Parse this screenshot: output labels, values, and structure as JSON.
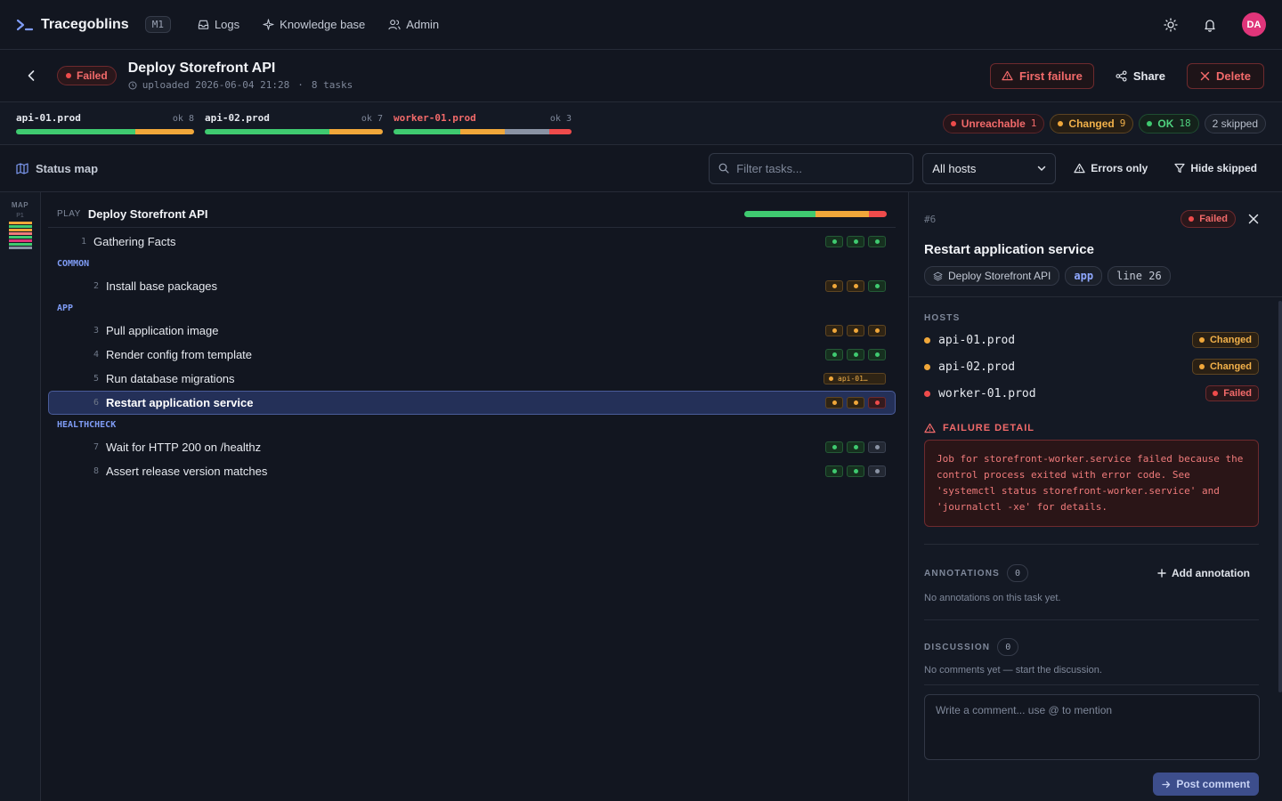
{
  "nav": {
    "brand": "Tracegoblins",
    "badge": "M1",
    "links": [
      {
        "label": "Logs",
        "icon": "inbox-icon"
      },
      {
        "label": "Knowledge base",
        "icon": "sparkle-icon"
      },
      {
        "label": "Admin",
        "icon": "users-icon"
      }
    ],
    "avatar": "DA"
  },
  "run": {
    "status": "Failed",
    "title": "Deploy Storefront API",
    "uploaded": "uploaded 2026-06-04 21:28",
    "separator": "·",
    "tasks": "8 tasks",
    "actions": {
      "first_failure": "First failure",
      "share": "Share",
      "delete": "Delete"
    }
  },
  "hosts": [
    {
      "name": "api-01.prod",
      "ok": "ok 8",
      "failed": false,
      "segments": [
        {
          "color": "#3fca70",
          "fraction": 0.67
        },
        {
          "color": "#f0a73a",
          "fraction": 0.33
        }
      ]
    },
    {
      "name": "api-02.prod",
      "ok": "ok 7",
      "failed": false,
      "segments": [
        {
          "color": "#3fca70",
          "fraction": 0.7
        },
        {
          "color": "#f0a73a",
          "fraction": 0.3
        }
      ]
    },
    {
      "name": "worker-01.prod",
      "ok": "ok 3",
      "failed": true,
      "segments": [
        {
          "color": "#3fca70",
          "fraction": 0.375
        },
        {
          "color": "#f0a73a",
          "fraction": 0.25
        },
        {
          "color": "#8a93a4",
          "fraction": 0.25
        },
        {
          "color": "#ef4b4b",
          "fraction": 0.125
        }
      ]
    }
  ],
  "summary": {
    "unreachable": {
      "label": "Unreachable",
      "count": "1"
    },
    "changed": {
      "label": "Changed",
      "count": "9"
    },
    "ok": {
      "label": "OK",
      "count": "18"
    },
    "skipped": "2 skipped"
  },
  "toolbar": {
    "status_map": "Status map",
    "filter_placeholder": "Filter tasks...",
    "host_select": "All hosts",
    "errors_only": "Errors only",
    "hide_skipped": "Hide skipped"
  },
  "minimap": {
    "label": "MAP",
    "sub": "P1"
  },
  "play": {
    "keyword": "PLAY",
    "name": "Deploy Storefront API",
    "bar": [
      {
        "color": "#3fca70",
        "fraction": 0.5
      },
      {
        "color": "#f0a73a",
        "fraction": 0.375
      },
      {
        "color": "#ef4b4b",
        "fraction": 0.125
      }
    ]
  },
  "task_rows": [
    {
      "kind": "task",
      "num": "1",
      "name": "Gathering Facts",
      "indent": 0,
      "dots": [
        "ok",
        "ok",
        "ok"
      ]
    },
    {
      "kind": "role",
      "name": "COMMON"
    },
    {
      "kind": "task",
      "num": "2",
      "name": "Install base packages",
      "indent": 1,
      "dots": [
        "changed",
        "changed",
        "ok"
      ]
    },
    {
      "kind": "role",
      "name": "APP"
    },
    {
      "kind": "task",
      "num": "3",
      "name": "Pull application image",
      "indent": 1,
      "dots": [
        "changed",
        "changed",
        "changed"
      ]
    },
    {
      "kind": "task",
      "num": "4",
      "name": "Render config from template",
      "indent": 1,
      "dots": [
        "ok",
        "ok",
        "ok"
      ]
    },
    {
      "kind": "task",
      "num": "5",
      "name": "Run database migrations",
      "indent": 1,
      "wide": "api-01…"
    },
    {
      "kind": "task",
      "num": "6",
      "name": "Restart application service",
      "indent": 1,
      "selected": true,
      "dots": [
        "changed",
        "changed",
        "failed"
      ]
    },
    {
      "kind": "role",
      "name": "HEALTHCHECK"
    },
    {
      "kind": "task",
      "num": "7",
      "name": "Wait for HTTP 200 on /healthz",
      "indent": 1,
      "dots": [
        "ok",
        "ok",
        "skipped"
      ]
    },
    {
      "kind": "task",
      "num": "8",
      "name": "Assert release version matches",
      "indent": 1,
      "dots": [
        "ok",
        "ok",
        "skipped"
      ]
    }
  ],
  "detail": {
    "id": "#6",
    "status": "Failed",
    "title": "Restart application service",
    "chips": {
      "play": "Deploy Storefront API",
      "role": "app",
      "line": "line 26"
    },
    "hosts_label": "HOSTS",
    "hosts": [
      {
        "name": "api-01.prod",
        "status": "Changed",
        "kind": "changed"
      },
      {
        "name": "api-02.prod",
        "status": "Changed",
        "kind": "changed"
      },
      {
        "name": "worker-01.prod",
        "status": "Failed",
        "kind": "failed"
      }
    ],
    "failure_label": "FAILURE DETAIL",
    "failure_text": "Job for storefront-worker.service failed because the control process exited with error code. See 'systemctl status storefront-worker.service' and 'journalctl -xe' for details.",
    "annotations": {
      "label": "ANNOTATIONS",
      "count": "0",
      "add": "Add annotation",
      "empty": "No annotations on this task yet."
    },
    "discussion": {
      "label": "DISCUSSION",
      "count": "0",
      "empty": "No comments yet — start the discussion."
    },
    "comment_placeholder": "Write a comment... use @ to mention",
    "post": "Post comment"
  }
}
